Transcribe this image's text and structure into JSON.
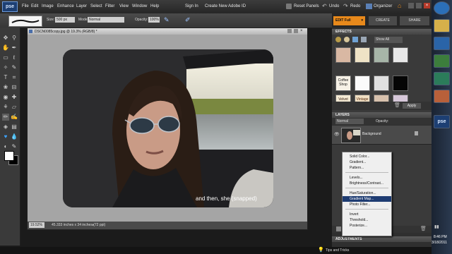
{
  "app": {
    "logo": "pse",
    "menus": [
      "File",
      "Edit",
      "Image",
      "Enhance",
      "Layer",
      "Select",
      "Filter",
      "View",
      "Window",
      "Help"
    ]
  },
  "account": {
    "sign_in": "Sign In",
    "create_id": "Create New Adobe ID"
  },
  "top_actions": {
    "reset_panels": "Reset Panels",
    "undo": "Undo",
    "redo": "Redo",
    "organizer": "Organizer"
  },
  "modes": {
    "edit_full": "EDIT Full",
    "create": "CREATE",
    "share": "SHARE"
  },
  "options_bar": {
    "size_label": "Size:",
    "size_value": "500 px",
    "mode_label": "Mode:",
    "mode_value": "Normal",
    "opacity_label": "Opacity:",
    "opacity_value": "100%"
  },
  "document": {
    "tab_title": "DSCN0085copy.jpg @ 19.3% (RGB/8) *",
    "caption": "and then, she (snapped)",
    "zoom": "19.52%",
    "doc_info": "45.333 inches x 34 inches (72 ppi)"
  },
  "effects": {
    "header": "EFFECTS",
    "filter": "Show All",
    "apply": "Apply",
    "thumbs": [
      "Coffee Shop",
      "",
      "",
      "Velvet Crush",
      "Vintage Truffle",
      "",
      ""
    ]
  },
  "layers": {
    "header": "LAYERS",
    "blend": "Normal",
    "opacity_label": "Opacity:",
    "layer_name": "Background"
  },
  "adjustment_menu": {
    "groups": [
      [
        "Solid Color...",
        "Gradient...",
        "Pattern..."
      ],
      [
        "Levels...",
        "Brightness/Contrast..."
      ],
      [
        "Hue/Saturation...",
        "Gradient Map...",
        "Photo Filter..."
      ],
      [
        "Invert",
        "Threshold...",
        "Posterize..."
      ]
    ],
    "highlighted": "Gradient Map..."
  },
  "adjustments": {
    "header": "ADJUSTMENTS"
  },
  "status": {
    "tips": "Tips and Tricks"
  },
  "taskbar": {
    "clock": "8:46 PM",
    "date": "3/18/2011",
    "pse_label": "pse"
  },
  "colors": {
    "accent": "#e8891b",
    "menu_highlight": "#1e3c72",
    "taskbar": "#1a2331"
  }
}
